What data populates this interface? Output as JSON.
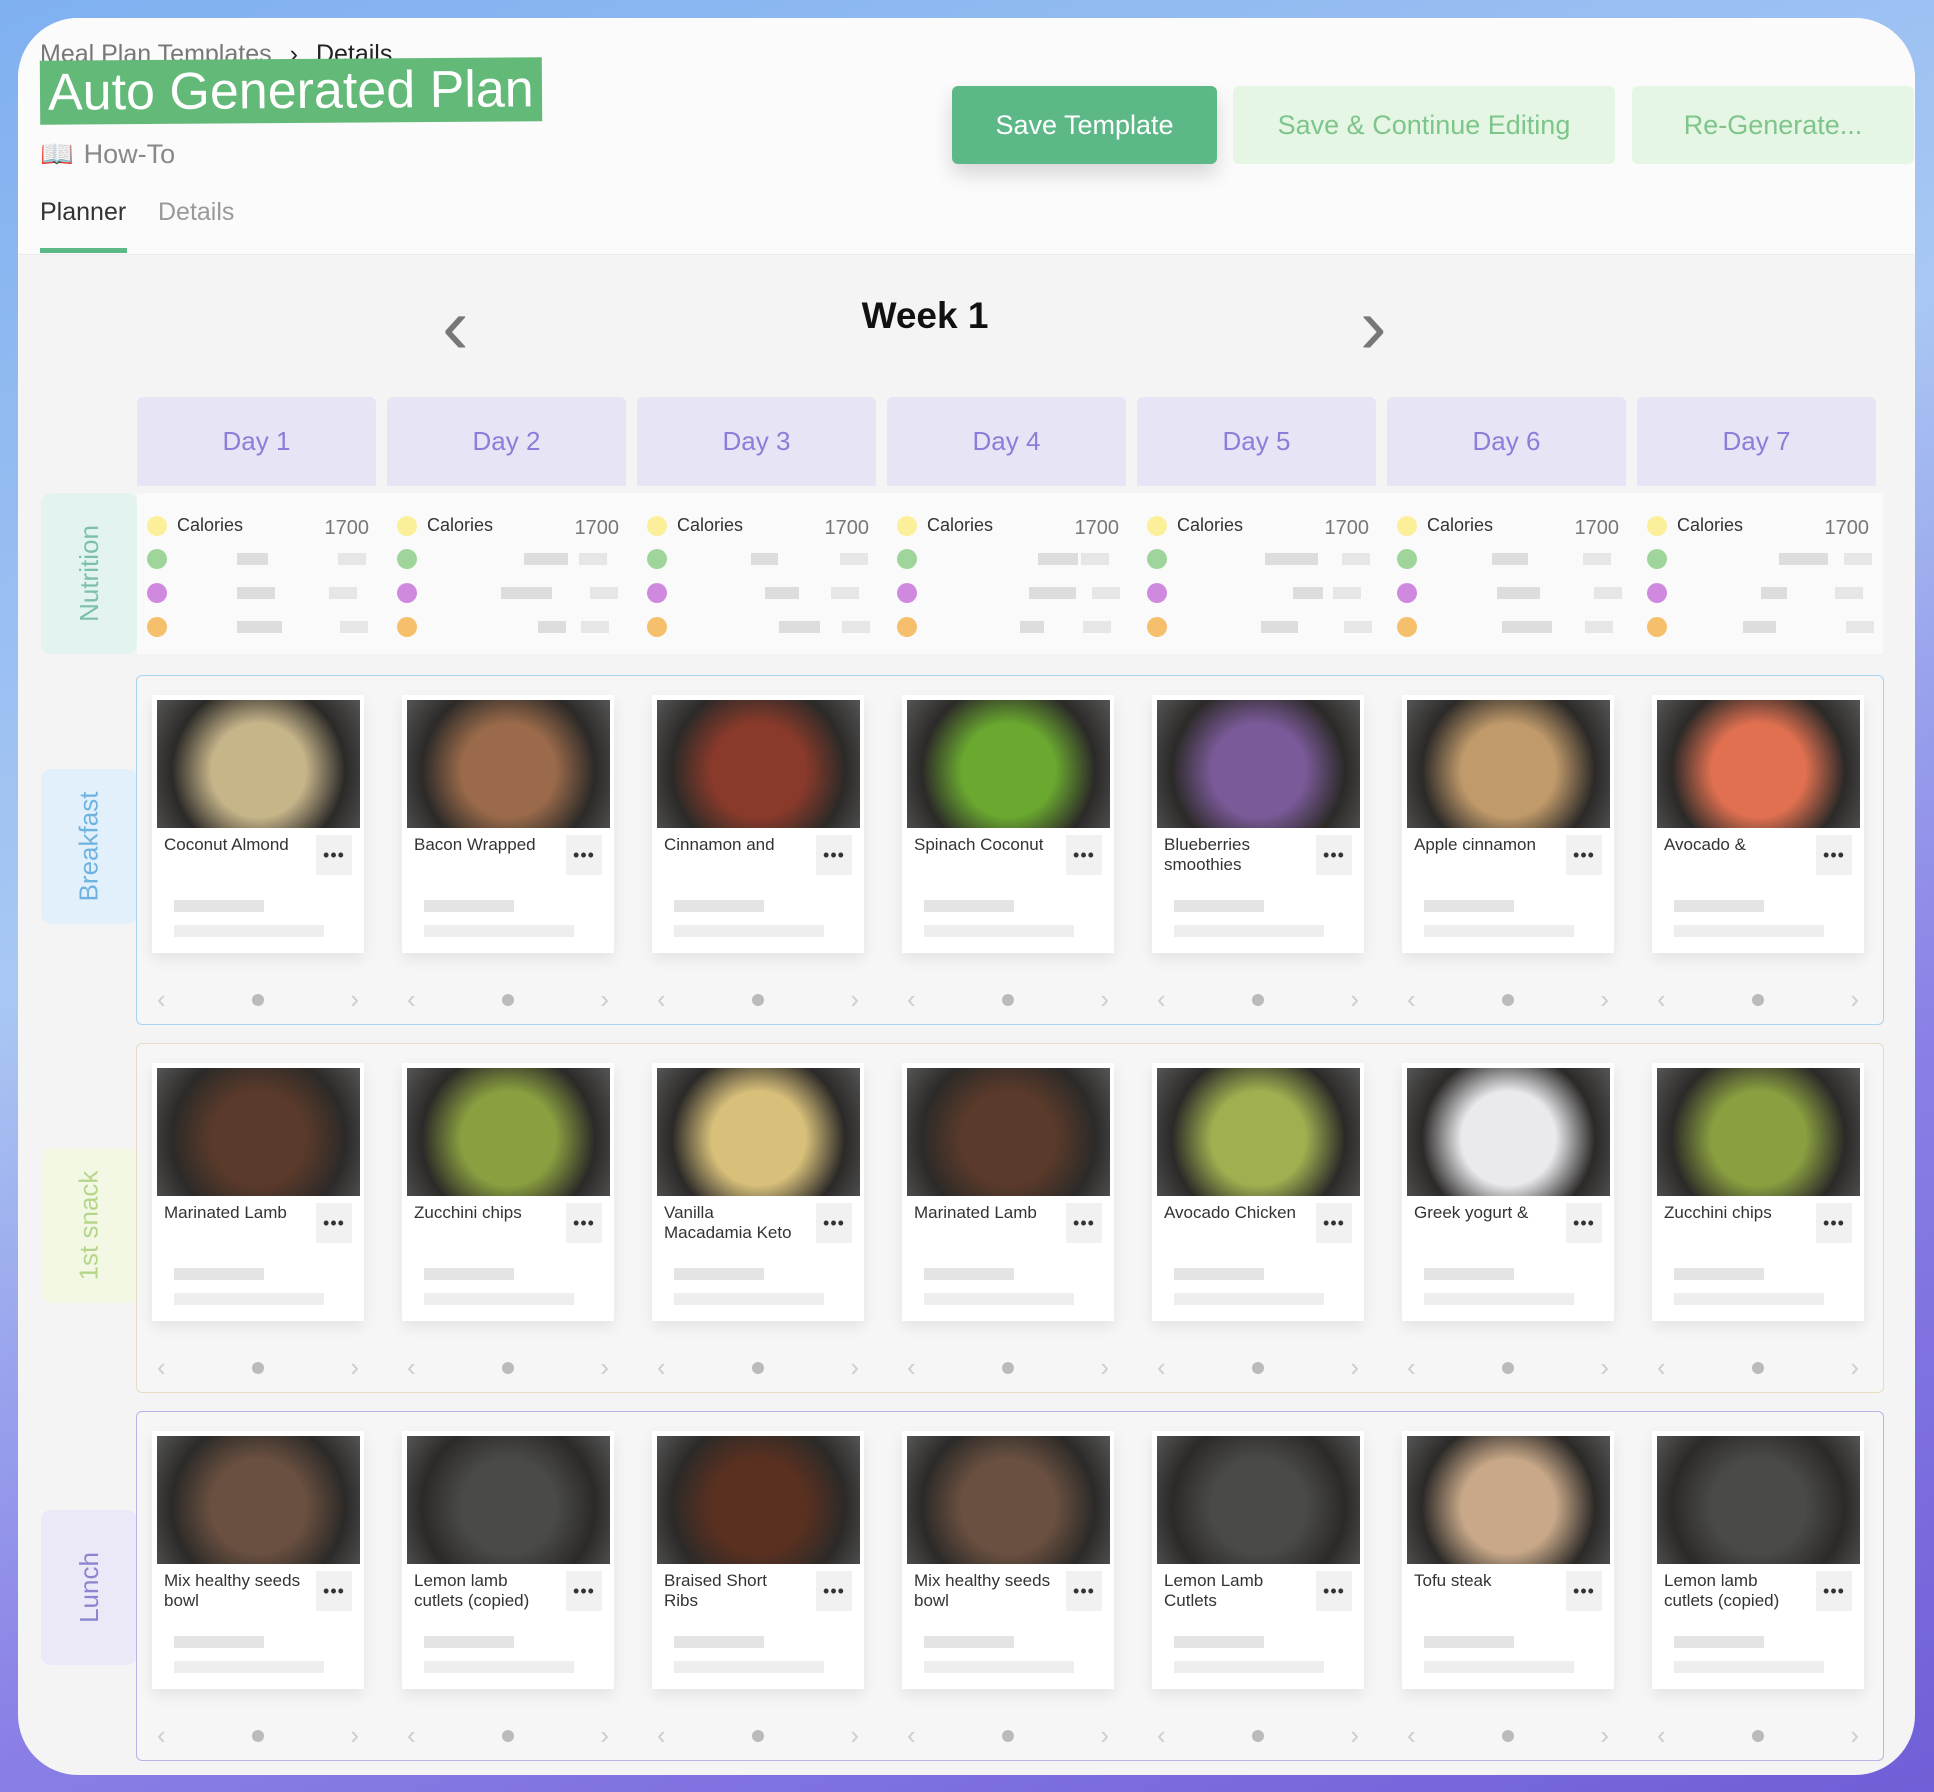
{
  "breadcrumb": {
    "parent": "Meal Plan Templates",
    "current": "Details"
  },
  "title": "Auto Generated Plan",
  "howto": "How-To",
  "buttons": {
    "save_template": "Save Template",
    "save_continue": "Save & Continue Editing",
    "regenerate": "Re-Generate..."
  },
  "tabs": [
    "Planner",
    "Details"
  ],
  "week": "Week 1",
  "days": [
    "Day 1",
    "Day 2",
    "Day 3",
    "Day 4",
    "Day 5",
    "Day 6",
    "Day 7"
  ],
  "row_labels": {
    "nutrition": "Nutrition",
    "breakfast": "Breakfast",
    "snack": "1st snack",
    "lunch": "Lunch"
  },
  "nutrition": {
    "label": "Calories",
    "value": "1700",
    "colors": [
      "#fbef9a",
      "#9fd49a",
      "#cf8ae0",
      "#f6bf6c"
    ]
  },
  "more_label": "•••",
  "meals": {
    "breakfast": [
      {
        "t": "Coconut Almond",
        "c": "#c7b58a"
      },
      {
        "t": "Bacon Wrapped",
        "c": "#9a6a4a"
      },
      {
        "t": "Cinnamon and",
        "c": "#8a3a2a"
      },
      {
        "t": "Spinach Coconut",
        "c": "#6aa830"
      },
      {
        "t": "Blueberries smoothies",
        "c": "#7a5a98"
      },
      {
        "t": "Apple cinnamon",
        "c": "#c09a6a"
      },
      {
        "t": "Avocado &",
        "c": "#e07050"
      }
    ],
    "snack": [
      {
        "t": "Marinated Lamb",
        "c": "#5a3a2a"
      },
      {
        "t": "Zucchini chips",
        "c": "#8aa040"
      },
      {
        "t": "Vanilla Macadamia Keto",
        "c": "#d8c07a"
      },
      {
        "t": "Marinated Lamb",
        "c": "#5a3a2a"
      },
      {
        "t": "Avocado Chicken",
        "c": "#a0b050"
      },
      {
        "t": "Greek yogurt &",
        "c": "#eaeaee"
      },
      {
        "t": "Zucchini chips",
        "c": "#8aa040"
      }
    ],
    "lunch": [
      {
        "t": "Mix healthy seeds bowl",
        "c": "#6a5040"
      },
      {
        "t": "Lemon lamb cutlets (copied)",
        "c": "#4a4a48"
      },
      {
        "t": "Braised Short Ribs",
        "c": "#5a3020"
      },
      {
        "t": "Mix healthy seeds bowl",
        "c": "#6a5040"
      },
      {
        "t": "Lemon Lamb Cutlets",
        "c": "#4a4a48"
      },
      {
        "t": "Tofu steak",
        "c": "#c8a888"
      },
      {
        "t": "Lemon lamb cutlets (copied)",
        "c": "#4a4a48"
      }
    ]
  },
  "colors": {
    "accent": "#5cb987",
    "breakfast_border": "#a9d2f0",
    "snack_border": "#e8dcc0",
    "lunch_border": "#b9b4e6"
  }
}
